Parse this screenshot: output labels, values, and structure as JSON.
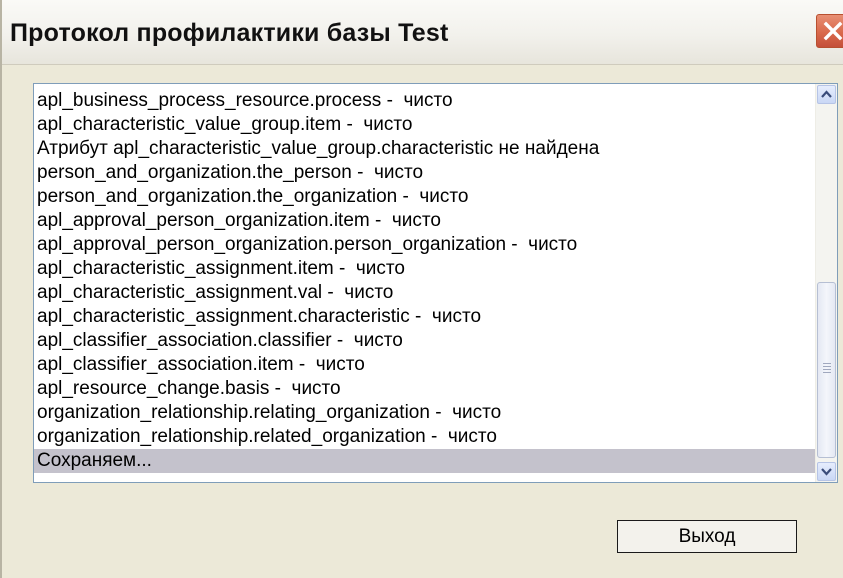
{
  "window": {
    "title": "Протокол профилактики базы Test"
  },
  "titlebar": {
    "close_icon": "close-icon",
    "close_color": "#d9694b"
  },
  "log": {
    "lines": [
      "apl_business_process_resource.process -  чисто",
      "apl_characteristic_value_group.item -  чисто",
      "Атрибут apl_characteristic_value_group.characteristic не найдена",
      "person_and_organization.the_person -  чисто",
      "person_and_organization.the_organization -  чисто",
      "apl_approval_person_organization.item -  чисто",
      "apl_approval_person_organization.person_organization -  чисто",
      "apl_characteristic_assignment.item -  чисто",
      "apl_characteristic_assignment.val -  чисто",
      "apl_characteristic_assignment.characteristic -  чисто",
      "apl_classifier_association.classifier -  чисто",
      "apl_classifier_association.item -  чисто",
      "apl_resource_change.basis -  чисто",
      "organization_relationship.relating_organization -  чисто",
      "organization_relationship.related_organization -  чисто",
      "Сохраняем..."
    ],
    "selected_index": 15,
    "scroll_up_icon": "chevron-up-icon",
    "scroll_down_icon": "chevron-down-icon"
  },
  "buttons": {
    "exit_label": "Выход"
  }
}
